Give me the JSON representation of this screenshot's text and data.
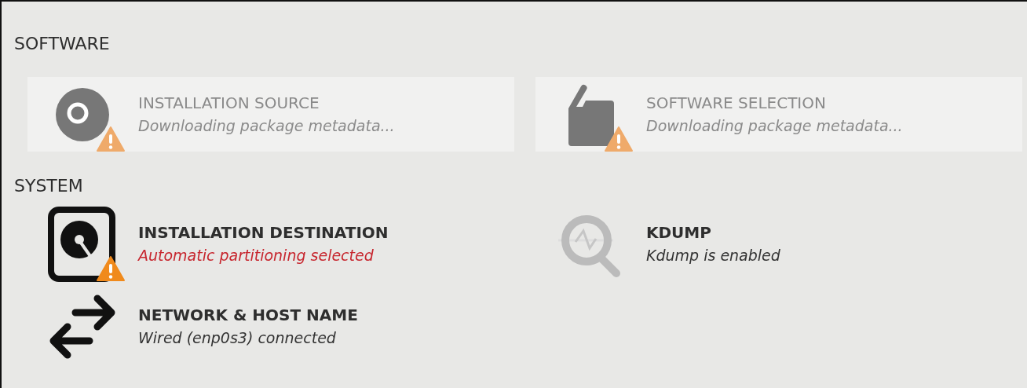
{
  "sections": [
    {
      "title": "SOFTWARE",
      "spokes": [
        {
          "kind": "disc",
          "title": "INSTALLATION SOURCE",
          "status": "Downloading package metadata...",
          "disabled": true,
          "warning": true,
          "error": false
        },
        {
          "kind": "package",
          "title": "SOFTWARE SELECTION",
          "status": "Downloading package metadata...",
          "disabled": true,
          "warning": true,
          "error": false
        }
      ]
    },
    {
      "title": "SYSTEM",
      "spokes": [
        {
          "kind": "harddisk",
          "title": "INSTALLATION DESTINATION",
          "status": "Automatic partitioning selected",
          "disabled": false,
          "warning": true,
          "error": true
        },
        {
          "kind": "kdump",
          "title": "KDUMP",
          "status": "Kdump is enabled",
          "disabled": false,
          "warning": false,
          "error": false
        },
        {
          "kind": "network",
          "title": "NETWORK & HOST NAME",
          "status": "Wired (enp0s3) connected",
          "disabled": false,
          "warning": false,
          "error": false
        }
      ]
    }
  ]
}
